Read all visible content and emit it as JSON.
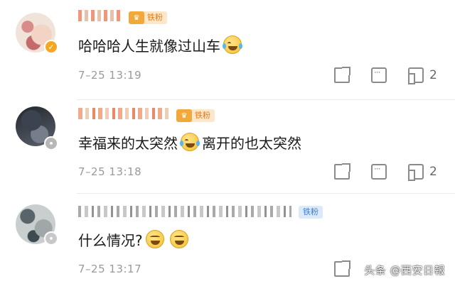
{
  "comments": [
    {
      "fan_badge": "铁粉",
      "text_before": "哈哈哈人生就像过山车",
      "emoji": "laugh-cry",
      "text_after": "",
      "time": "7–25 13:19",
      "likes": "2"
    },
    {
      "fan_badge": "铁粉",
      "text_before": "幸福来的太突然",
      "emoji": "laugh-cry",
      "text_after": "离开的也太突然",
      "time": "7–25 13:18",
      "likes": "2"
    },
    {
      "fan_badge": "铁粉",
      "text_before": "什么情况?",
      "emoji": "grin",
      "text_after": "",
      "time": "7–25 13:17",
      "likes": ""
    }
  ],
  "watermark": "头条 @西安日報",
  "colors": {
    "fan_badge_orange": "#f2a93b",
    "fan_badge_blue": "#3d7fd6",
    "meta_gray": "#9a9a9a"
  },
  "icons": [
    "share-icon",
    "comment-icon",
    "like-icon",
    "fan-badge-icon",
    "verified-badge-icon"
  ]
}
